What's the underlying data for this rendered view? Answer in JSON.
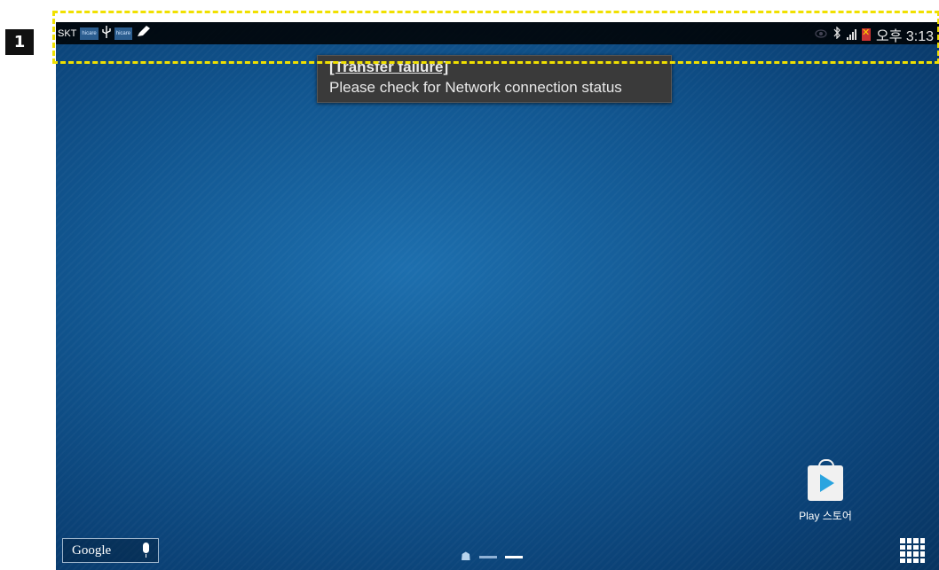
{
  "annotation": {
    "step_number": "1",
    "highlight_color": "#f0e000"
  },
  "status_bar": {
    "carrier": "SKT",
    "left_icons": [
      "hicare",
      "usb-icon",
      "hicare",
      "pencil-icon"
    ],
    "right_icons": [
      "eye-icon",
      "bluetooth-icon",
      "signal-icon",
      "battery-icon"
    ],
    "time": "오후 3:13",
    "mini_icon_label": "hicare"
  },
  "toast": {
    "title": "[Transfer failure]",
    "message": "Please check for Network connection status"
  },
  "home_screen": {
    "search_widget_label": "Google",
    "play_store_label": "Play 스토어",
    "page_count": 2,
    "current_page": 2
  },
  "colors": {
    "wallpaper": "#11558f",
    "toast_bg": "#3a3a3a",
    "status_bar_bg": "#000000"
  }
}
